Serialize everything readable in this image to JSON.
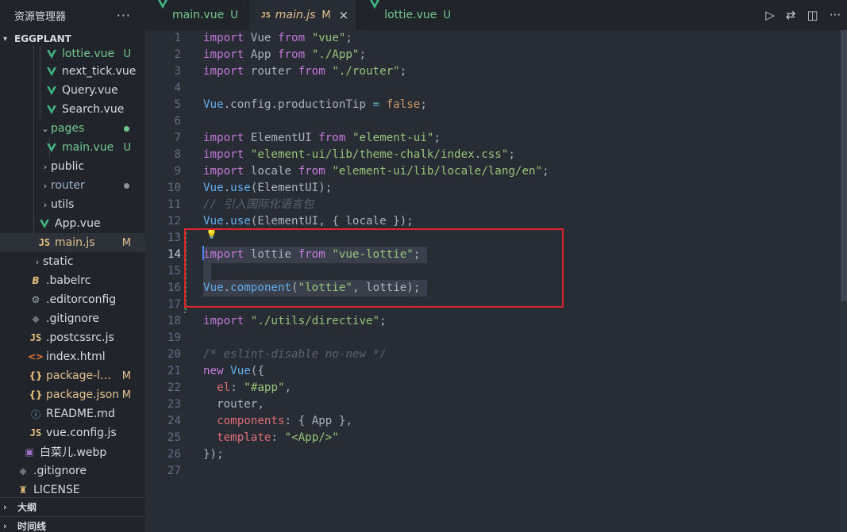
{
  "explorer": {
    "title": "资源管理器",
    "more": "···",
    "root": "EGGPLANT",
    "items": [
      {
        "label": "lottie.vue",
        "badge": "U"
      },
      {
        "label": "next_tick.vue"
      },
      {
        "label": "Query.vue"
      },
      {
        "label": "Search.vue"
      },
      {
        "label": "pages"
      },
      {
        "label": "main.vue",
        "badge": "U"
      },
      {
        "label": "public"
      },
      {
        "label": "router"
      },
      {
        "label": "utils"
      },
      {
        "label": "App.vue"
      },
      {
        "label": "main.js",
        "badge": "M"
      },
      {
        "label": "static"
      },
      {
        "label": ".babelrc"
      },
      {
        "label": ".editorconfig"
      },
      {
        "label": ".gitignore"
      },
      {
        "label": ".postcssrc.js"
      },
      {
        "label": "index.html"
      },
      {
        "label": "package-loc...",
        "badge": "M"
      },
      {
        "label": "package.json",
        "badge": "M"
      },
      {
        "label": "README.md"
      },
      {
        "label": "vue.config.js"
      },
      {
        "label": "白菜儿.webp"
      },
      {
        "label": ".gitignore"
      },
      {
        "label": "LICENSE"
      }
    ],
    "outline": "大纲",
    "timeline": "时间线"
  },
  "tabs": [
    {
      "label": "main.vue",
      "badge": "U"
    },
    {
      "label": "main.js",
      "badge": "M",
      "close": "×"
    },
    {
      "label": "lottie.vue",
      "badge": "U"
    }
  ],
  "editor": {
    "line_numbers": [
      "1",
      "2",
      "3",
      "4",
      "5",
      "6",
      "7",
      "8",
      "9",
      "10",
      "11",
      "12",
      "13",
      "14",
      "15",
      "16",
      "17",
      "18",
      "19",
      "20",
      "21",
      "22",
      "23",
      "24",
      "25",
      "26",
      "27"
    ],
    "tokens": {
      "import": "import",
      "from": "from",
      "new": "new",
      "false": "false",
      "Vue": "Vue",
      "App": "App",
      "router": "router",
      "ElementUI": "ElementUI",
      "locale": "locale",
      "lottie": "lottie",
      "s_vue": "\"vue\"",
      "s_app": "\"./App\"",
      "s_router": "\"./router\"",
      "s_element": "\"element-ui\"",
      "s_css": "\"element-ui/lib/theme-chalk/index.css\"",
      "s_locale": "\"element-ui/lib/locale/lang/en\"",
      "s_vuelottie": "\"vue-lottie\"",
      "s_lottie": "\"lottie\"",
      "s_directive": "\"./utils/directive\"",
      "s_app_sel": "\"#app\"",
      "s_tpl": "\"<App/>\"",
      "config": ".config.productionTip",
      "use": "use",
      "component": "component",
      "comment_cn": "// 引入国际化语言包",
      "comment_eslint": "/* eslint-disable no-new */",
      "el": "el",
      "components": "components",
      "template": "template"
    }
  }
}
